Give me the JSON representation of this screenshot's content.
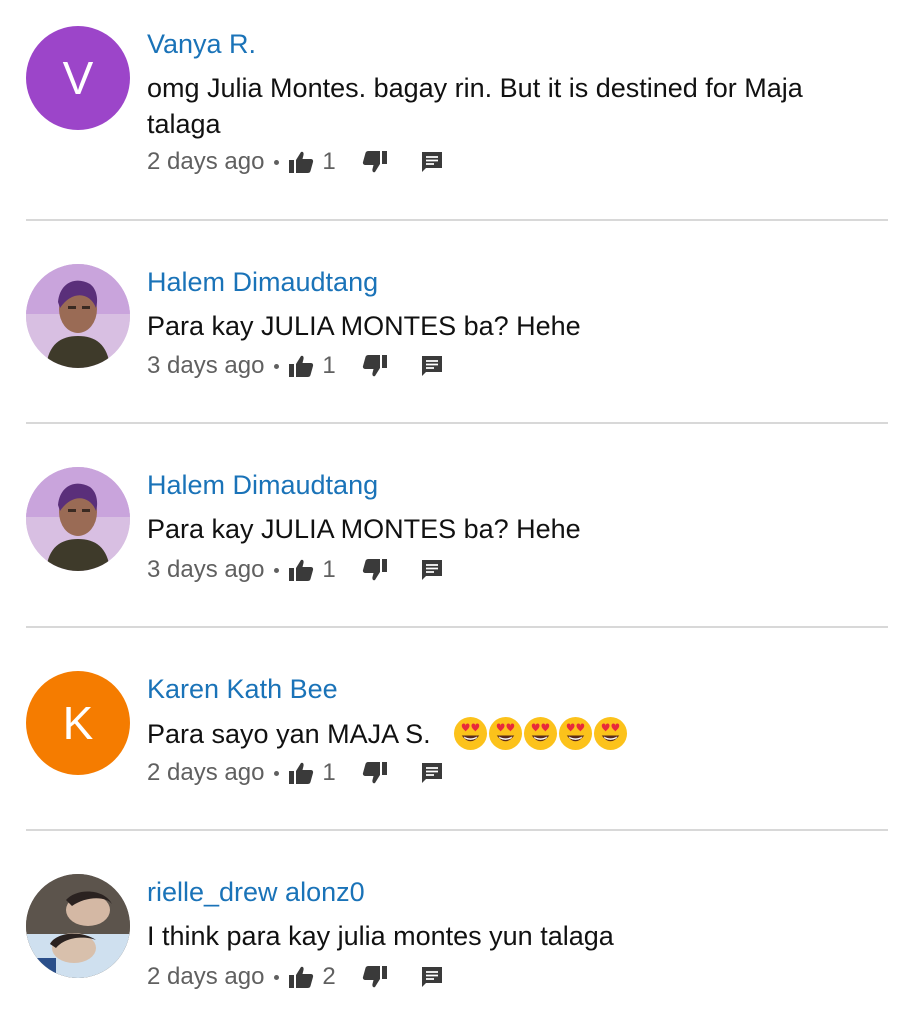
{
  "comments": [
    {
      "author": "Vanya R.",
      "avatar_letter": "V",
      "avatar_color": "#9c45c9",
      "text": "omg Julia Montes. bagay rin. But it is destined for Maja talaga",
      "time": "2 days ago",
      "likes": "1"
    },
    {
      "author": "Halem Dimaudtang",
      "text": "Para kay JULIA MONTES ba? Hehe",
      "time": "3 days ago",
      "likes": "1"
    },
    {
      "author": "Halem Dimaudtang",
      "text": "Para kay JULIA MONTES ba? Hehe",
      "time": "3 days ago",
      "likes": "1"
    },
    {
      "author": "Karen Kath Bee",
      "avatar_letter": "K",
      "avatar_color": "#f57c00",
      "text": "Para sayo yan MAJA S.",
      "emoji": "heart-eyes-face",
      "emoji_count": 5,
      "time": "2 days ago",
      "likes": "1"
    },
    {
      "author": "rielle_drew alonz0",
      "text": "I think para kay julia montes yun talaga",
      "time": "2 days ago",
      "likes": "2"
    }
  ]
}
